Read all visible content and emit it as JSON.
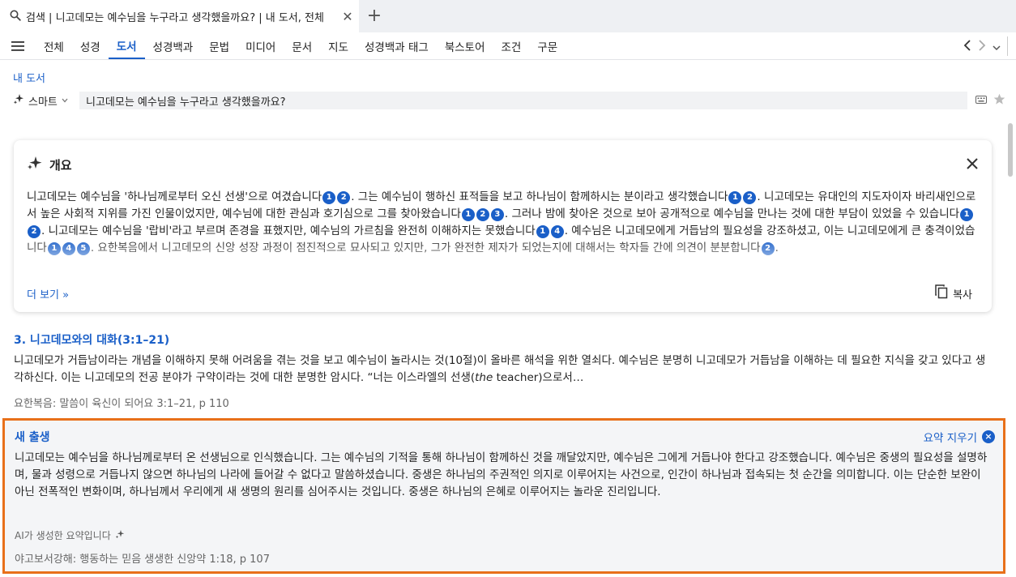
{
  "tab": {
    "title": "검색 | 니고데모는 예수님을 누구라고 생각했을까요? | 내 도서, 전체",
    "close": "✕",
    "add": "+"
  },
  "filters": [
    "전체",
    "성경",
    "도서",
    "성경백과",
    "문법",
    "미디어",
    "문서",
    "지도",
    "성경백과 태그",
    "북스토어",
    "조건",
    "구문"
  ],
  "active_filter": "도서",
  "scope": {
    "link": "내 도서",
    "mode": "스마트",
    "query": "니고데모는 예수님을 누구라고 생각했을까요?"
  },
  "overview": {
    "title": "개요",
    "more": "더 보기 »",
    "copy": "복사",
    "segments": [
      {
        "t": "니고데모는 예수님을 '하나님께로부터 오신 선생'으로 여겼습니다",
        "c": [
          "1",
          "2"
        ]
      },
      {
        "t": ". 그는 예수님이 행하신 표적들을 보고 하나님이 함께하시는 분이라고 생각했습니다",
        "c": [
          "1",
          "2"
        ]
      },
      {
        "t": ". 니고데모는 유대인의 지도자이자 바리새인으로서 높은 사회적 지위를 가진 인물이었지만, 예수님에 대한 관심과 호기심으로 그를 찾아왔습니다",
        "c": [
          "1",
          "2",
          "3"
        ]
      },
      {
        "t": ". 그러나 밤에 찾아온 것으로 보아 공개적으로 예수님을 만나는 것에 대한 부담이 있었을 수 있습니다",
        "c": [
          "1",
          "2"
        ]
      },
      {
        "t": ". 니고데모는 예수님을 '랍비'라고 부르며 존경을 표했지만, 예수님의 가르침을 완전히 이해하지는 못했습니다",
        "c": [
          "1",
          "4"
        ]
      },
      {
        "t": ". 예수님은 니고데모에게 거듭남의 필요성을 강조하셨고, 이는 니고데모에게 큰 충격이었습니다",
        "c": [
          "1",
          "4",
          "5"
        ]
      },
      {
        "t": ". 요한복음에서 니고데모의 신앙 성장 과정이 점진적으로 묘사되고 있지만, 그가 완전한 제자가 되었는지에 대해서는 학자들 간에 의견이 분분합니다",
        "c": [
          "2"
        ]
      },
      {
        "t": ".",
        "c": []
      }
    ]
  },
  "result": {
    "title": "3. 니고데모와의 대화(3:1–21)",
    "body_before": "니고데모가 거듭남이라는 개념을 이해하지 못해 어려움을 겪는 것을 보고 예수님이 놀라시는 것(10절)이 올바른 해석을 위한 열쇠다. 예수님은 분명히 니고데모가 거듭남을 이해하는 데 필요한 지식을 갖고 있다고 생각하신다. 이는 니고데모의 전공 분야가 구약이라는 것에 대한 분명한 암시다. “너는 이스라엘의 선생(",
    "body_italic": "the",
    "body_after": " teacher)으로서…",
    "source": "요한복음: 말씀이 육신이 되어요 3:1–21, p 110"
  },
  "summary": {
    "title": "새 출생",
    "clear": "요약 지우기",
    "body": "니고데모는 예수님을 하나님께로부터 온 선생님으로 인식했습니다. 그는 예수님의 기적을 통해 하나님이 함께하신 것을 깨달았지만, 예수님은 그에게 거듭나야 한다고 강조했습니다. 예수님은 중생의 필요성을 설명하며, 물과 성령으로 거듭나지 않으면 하나님의 나라에 들어갈 수 없다고 말씀하셨습니다. 중생은 하나님의 주권적인 의지로 이루어지는 사건으로, 인간이 하나님과 접속되는 첫 순간을 의미합니다. 이는 단순한 보완이 아닌 전폭적인 변화이며, 하나님께서 우리에게 새 생명의 원리를 심어주시는 것입니다. 중생은 하나님의 은혜로 이루어지는 놀라운 진리입니다.",
    "ai_note": "AI가 생성한 요약입니다",
    "source": "야고보서강해: 행동하는 믿음 생생한 신앙약 1:18, p 107"
  },
  "colors": {
    "accent": "#1a5fc8",
    "highlight": "#e8701a"
  },
  "icons": [
    "search-icon",
    "close-icon",
    "plus-icon",
    "menu-icon",
    "chevron-left-icon",
    "chevron-right-icon",
    "chevron-down-icon",
    "sparkle-icon",
    "keyboard-icon",
    "star-icon",
    "copy-icon",
    "clear-icon"
  ]
}
